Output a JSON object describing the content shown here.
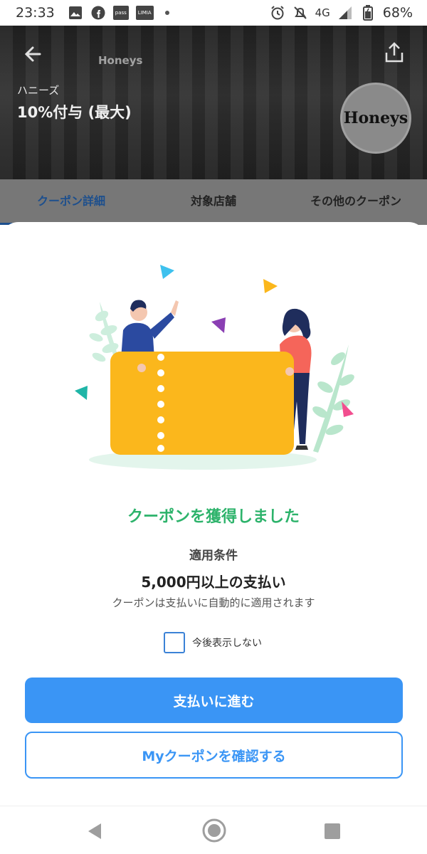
{
  "status_bar": {
    "time": "23:33",
    "network": "4G",
    "battery": "68%",
    "notif_badges": [
      "pass",
      "LIMIA"
    ],
    "icons": [
      "image-icon",
      "facebook-icon",
      "alarm-icon",
      "mute-icon",
      "signal-icon",
      "battery-icon"
    ]
  },
  "hero": {
    "store_name": "ハニーズ",
    "offer_title": "10%付与 (最大)",
    "logo_text": "Honeys",
    "sign_text": "Honeys"
  },
  "tabs": [
    {
      "label": "クーポン詳細",
      "active": true
    },
    {
      "label": "対象店舗",
      "active": false
    },
    {
      "label": "その他のクーポン",
      "active": false
    }
  ],
  "modal": {
    "headline": "クーポンを獲得しました",
    "condition_label": "適用条件",
    "condition_value": "5,000円以上の支払い",
    "note": "クーポンは支払いに自動的に適用されます",
    "checkbox_label": "今後表示しない",
    "checkbox_checked": false,
    "primary_button": "支払いに進む",
    "secondary_button": "Myクーポンを確認する"
  },
  "colors": {
    "accent_blue": "#3a95f5",
    "success_green": "#2db36b",
    "ticket_yellow": "#fbb71c"
  }
}
